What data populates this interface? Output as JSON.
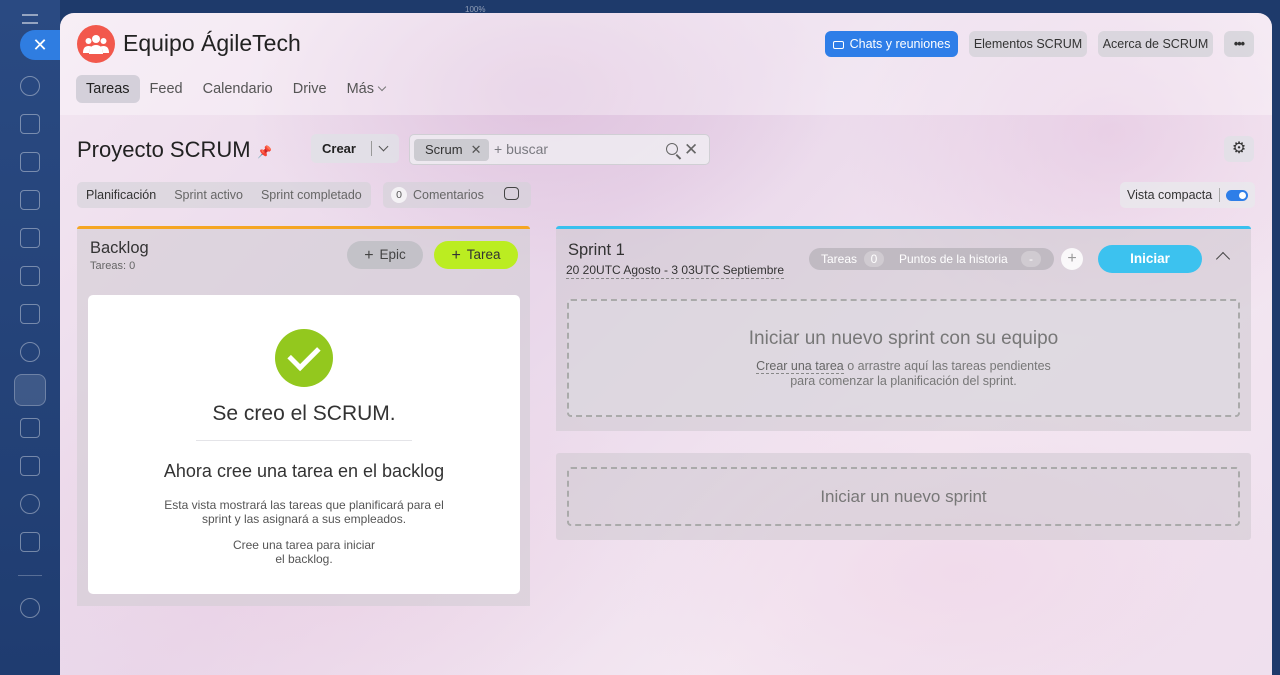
{
  "browser": {
    "zoom": "100%"
  },
  "header": {
    "team_title": "Equipo ÁgileTech",
    "buttons": {
      "chats": "Chats y reuniones",
      "elements": "Elementos SCRUM",
      "about": "Acerca de SCRUM",
      "more": "•••"
    },
    "nav": [
      {
        "label": "Tareas",
        "active": true
      },
      {
        "label": "Feed"
      },
      {
        "label": "Calendario"
      },
      {
        "label": "Drive"
      },
      {
        "label": "Más"
      }
    ]
  },
  "toolbar": {
    "page_title": "Proyecto SCRUM",
    "create_label": "Crear",
    "search": {
      "chip": "Scrum",
      "placeholder": "+ buscar"
    }
  },
  "tabs": {
    "planning": "Planificación",
    "active_sprint": "Sprint activo",
    "completed_sprint": "Sprint completado"
  },
  "comments": {
    "count": "0",
    "label": "Comentarios"
  },
  "compact_view": {
    "label": "Vista compacta",
    "enabled": true
  },
  "backlog": {
    "title": "Backlog",
    "subtitle": "Tareas: 0",
    "epic_label": "Epic",
    "task_label": "Tarea",
    "card": {
      "heading": "Se creo el SCRUM.",
      "subheading": "Ahora cree una tarea en el backlog",
      "desc_line1": "Esta vista mostrará las tareas que planificará para el",
      "desc_line2": "sprint y las asignará a sus empleados.",
      "hint_line1": "Cree una tarea para iniciar",
      "hint_line2": "el backlog."
    }
  },
  "sprint": {
    "title": "Sprint 1",
    "dates": "20 20UTC Agosto - 3 03UTC Septiembre",
    "stats": {
      "tasks_label": "Tareas",
      "tasks_count": "0",
      "points_label": "Puntos de la historia",
      "points_value": "-"
    },
    "start_label": "Iniciar",
    "dropzone": {
      "heading": "Iniciar un nuevo sprint con su equipo",
      "link": "Crear una tarea",
      "text_rest": " o arrastre aquí las tareas pendientes",
      "text_line2": "para comenzar la planificación del sprint."
    }
  },
  "new_sprint": {
    "label": "Iniciar un nuevo sprint"
  },
  "colors": {
    "accent": "#2e7ee8",
    "backlog_border": "#f5a623",
    "sprint_border": "#39c0ee",
    "task_button": "#bbed21",
    "check": "#93c81e"
  }
}
